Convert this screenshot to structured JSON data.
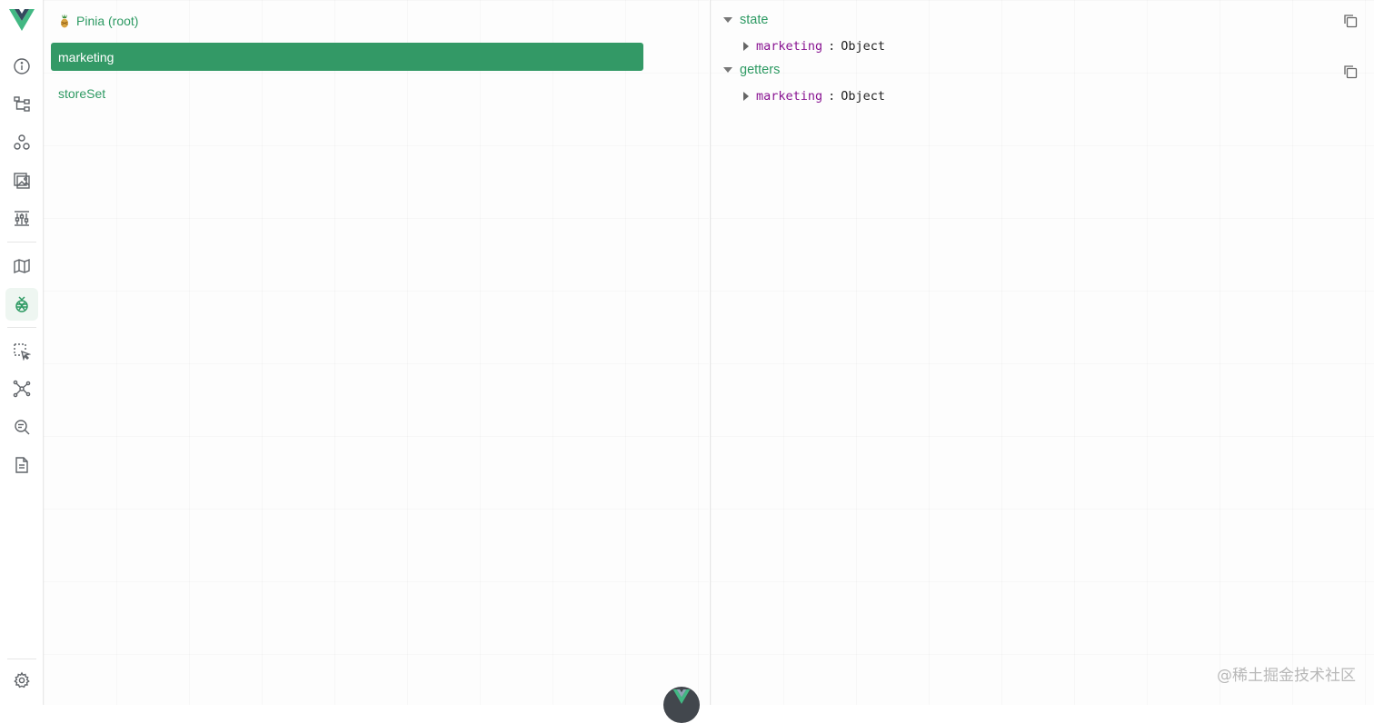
{
  "stores": [
    {
      "label": "Pinia (root)",
      "root": true
    },
    {
      "label": "marketing",
      "selected": true
    },
    {
      "label": "storeSet"
    }
  ],
  "inspector": {
    "sections": [
      {
        "title": "state",
        "props": [
          {
            "key": "marketing",
            "value": "Object"
          }
        ]
      },
      {
        "title": "getters",
        "props": [
          {
            "key": "marketing",
            "value": "Object"
          }
        ]
      }
    ]
  },
  "sidebar_icons": [
    "info-icon",
    "component-tree-icon",
    "components-icon",
    "assets-icon",
    "timeline-icon",
    "map-icon",
    "pinia-icon",
    "select-component-icon",
    "graph-icon",
    "inspect-icon",
    "document-icon",
    "settings-icon"
  ],
  "watermark": "@稀土掘金技术社区",
  "colors": {
    "accent": "#339966",
    "accent_text": "#2e9a63",
    "key_purple": "#881391",
    "vue_dark": "#35495e"
  }
}
